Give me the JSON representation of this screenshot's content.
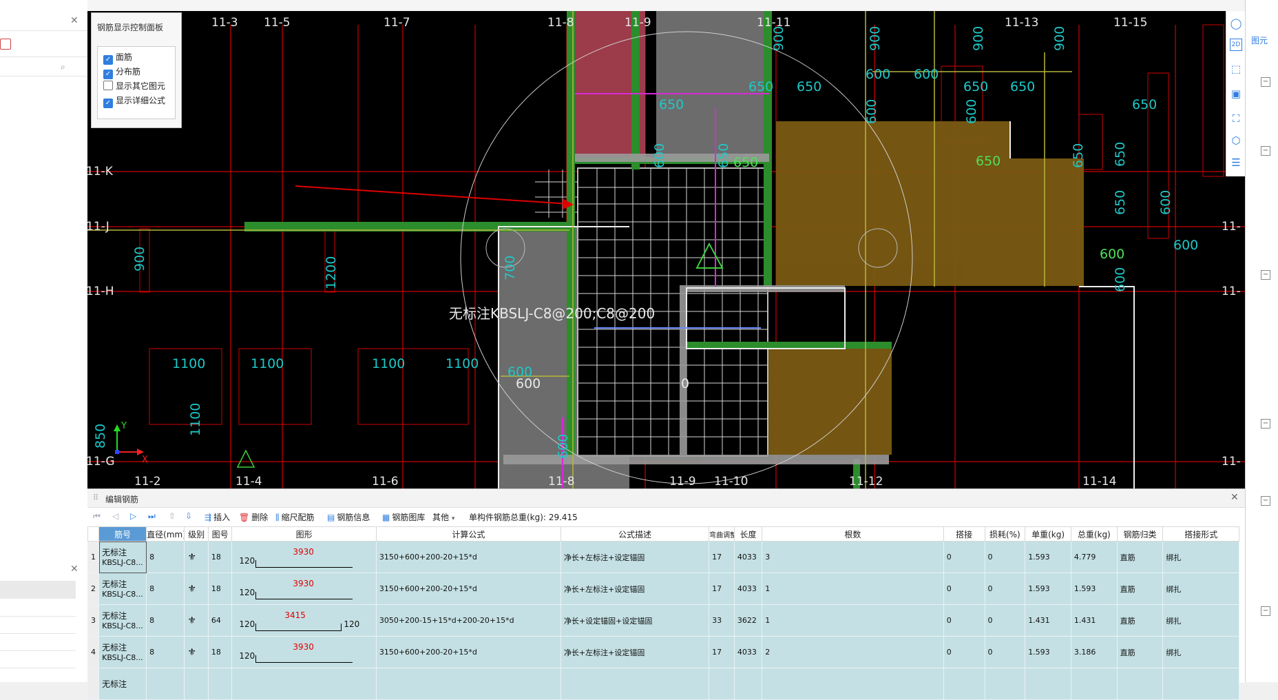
{
  "control_panel": {
    "title": "钢筋显示控制面板",
    "options": [
      {
        "label": "面筋",
        "checked": true
      },
      {
        "label": "分布筋",
        "checked": true
      },
      {
        "label": "显示其它图元",
        "checked": false
      },
      {
        "label": "显示详细公式",
        "checked": true
      }
    ]
  },
  "canvas": {
    "axis_labels_top": [
      "11-3",
      "11-5",
      "11-7",
      "11-8",
      "11-9",
      "11-11",
      "11-13",
      "11-15"
    ],
    "axis_labels_bottom": [
      "11-2",
      "11-4",
      "11-6",
      "11-8",
      "11-9",
      "11-10",
      "11-12",
      "11-14"
    ],
    "axis_labels_left": [
      "11-K",
      "11-J",
      "11-H",
      "11-G"
    ],
    "axis_labels_right": [
      "11-",
      "11-",
      "11-"
    ],
    "rebar_label": "无标注KBSLJ-C8@200;C8@200",
    "dimension_texts": {
      "d600": "600",
      "d650": "650",
      "d900": "900",
      "d1100": "1100",
      "d1200": "1200",
      "d700": "700",
      "d850": "850",
      "d0": "0"
    },
    "ucs": {
      "x": "X",
      "y": "Y"
    }
  },
  "right_panel": {
    "tab": "图元"
  },
  "edit_panel": {
    "title": "编辑钢筋",
    "toolbar": {
      "insert": "插入",
      "delete": "删除",
      "scale_rebar": "缩尺配筋",
      "rebar_info": "钢筋信息",
      "rebar_library": "钢筋图库",
      "other": "其他",
      "total_weight_label": "单构件钢筋总重(kg):",
      "total_weight_value": "29.415"
    },
    "columns": [
      "筋号",
      "直径(mm)",
      "级别",
      "图号",
      "图形",
      "计算公式",
      "公式描述",
      "弯曲调整",
      "长度",
      "根数",
      "搭接",
      "损耗(%)",
      "单重(kg)",
      "总重(kg)",
      "钢筋归类",
      "搭接形式"
    ],
    "rows": [
      {
        "no": "1",
        "name1": "无标注",
        "name2": "KBSLJ-C8...",
        "dia": "8",
        "grade": "⚜",
        "fig": "18",
        "shape": {
          "a": "120",
          "v": "3930",
          "b": ""
        },
        "formula": "3150+600+200-20+15*d",
        "desc": "净长+左标注+设定锚固",
        "bend": "17",
        "len": "4033",
        "count": "3",
        "lap": "0",
        "loss": "0",
        "unit_w": "1.593",
        "total_w": "4.779",
        "cat": "直筋",
        "lap_form": "绑扎"
      },
      {
        "no": "2",
        "name1": "无标注",
        "name2": "KBSLJ-C8...",
        "dia": "8",
        "grade": "⚜",
        "fig": "18",
        "shape": {
          "a": "120",
          "v": "3930",
          "b": ""
        },
        "formula": "3150+600+200-20+15*d",
        "desc": "净长+左标注+设定锚固",
        "bend": "17",
        "len": "4033",
        "count": "1",
        "lap": "0",
        "loss": "0",
        "unit_w": "1.593",
        "total_w": "1.593",
        "cat": "直筋",
        "lap_form": "绑扎"
      },
      {
        "no": "3",
        "name1": "无标注",
        "name2": "KBSLJ-C8...",
        "dia": "8",
        "grade": "⚜",
        "fig": "64",
        "shape": {
          "a": "120",
          "v": "3415",
          "b": "120"
        },
        "formula": "3050+200-15+15*d+200-20+15*d",
        "desc": "净长+设定锚固+设定锚固",
        "bend": "33",
        "len": "3622",
        "count": "1",
        "lap": "0",
        "loss": "0",
        "unit_w": "1.431",
        "total_w": "1.431",
        "cat": "直筋",
        "lap_form": "绑扎"
      },
      {
        "no": "4",
        "name1": "无标注",
        "name2": "KBSLJ-C8...",
        "dia": "8",
        "grade": "⚜",
        "fig": "18",
        "shape": {
          "a": "120",
          "v": "3930",
          "b": ""
        },
        "formula": "3150+600+200-20+15*d",
        "desc": "净长+左标注+设定锚固",
        "bend": "17",
        "len": "4033",
        "count": "2",
        "lap": "0",
        "loss": "0",
        "unit_w": "1.593",
        "total_w": "3.186",
        "cat": "直筋",
        "lap_form": "绑扎"
      },
      {
        "no": "",
        "name1": "无标注",
        "name2": "",
        "dia": "",
        "grade": "",
        "fig": "",
        "shape": {
          "a": "",
          "v": "",
          "b": ""
        },
        "formula": "",
        "desc": "",
        "bend": "",
        "len": "",
        "count": "",
        "lap": "",
        "loss": "",
        "unit_w": "",
        "total_w": "",
        "cat": "",
        "lap_form": ""
      }
    ]
  },
  "colors": {
    "grid": "#e00000",
    "cyan": "#1fc8c8",
    "green": "#3aa845",
    "brown": "#7a5a12",
    "yellow": "#c8c83a",
    "selection": "#c4e0e4"
  }
}
